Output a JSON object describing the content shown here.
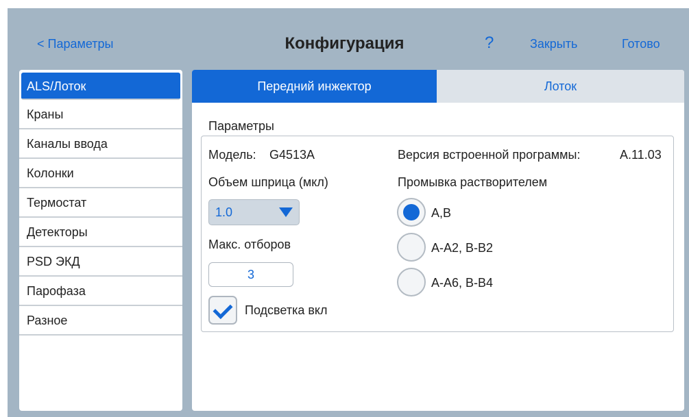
{
  "header": {
    "back_label": "< Параметры",
    "title": "Конфигурация",
    "help_label": "?",
    "close_label": "Закрыть",
    "done_label": "Готово"
  },
  "sidebar": {
    "items": [
      {
        "label": "ALS/Лоток",
        "selected": true
      },
      {
        "label": "Краны"
      },
      {
        "label": "Каналы ввода"
      },
      {
        "label": "Колонки"
      },
      {
        "label": "Термостат"
      },
      {
        "label": "Детекторы"
      },
      {
        "label": "PSD ЭКД"
      },
      {
        "label": "Парофаза"
      },
      {
        "label": "Разное"
      }
    ]
  },
  "tabs": [
    {
      "label": "Передний инжектор",
      "active": true
    },
    {
      "label": "Лоток",
      "active": false
    }
  ],
  "params": {
    "section_title": "Параметры",
    "model_label": "Модель:",
    "model_value": "G4513A",
    "firmware_label": "Версия встроенной программы:",
    "firmware_value": "A.11.03",
    "syringe_label": "Объем шприца (мкл)",
    "syringe_value": "1.0",
    "max_draws_label": "Макс. отборов",
    "max_draws_value": "3",
    "backlight_label": "Подсветка вкл",
    "backlight_checked": true,
    "solvent_wash_label": "Промывка растворителем",
    "solvent_options": [
      {
        "label": "A,B",
        "selected": true
      },
      {
        "label": "A-A2, B-B2",
        "selected": false
      },
      {
        "label": "A-A6, B-B4",
        "selected": false
      }
    ]
  },
  "colors": {
    "accent": "#1368d6",
    "frame": "#a3b5c4",
    "tab_inactive": "#dde3e9"
  }
}
